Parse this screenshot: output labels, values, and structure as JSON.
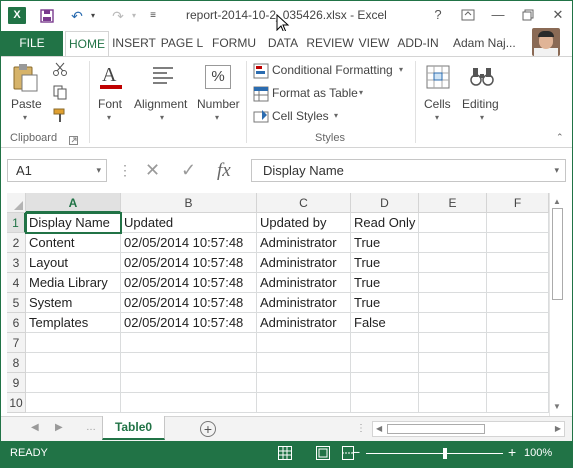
{
  "titlebar": {
    "app_logo": "X",
    "title": "report-2014-10-2_035426.xlsx - Excel",
    "help": "?",
    "minimize": "—",
    "close": "✕"
  },
  "tabs": {
    "file": "FILE",
    "items": [
      "HOME",
      "INSERT",
      "PAGE L",
      "FORMU",
      "DATA",
      "REVIEW",
      "VIEW",
      "ADD-IN"
    ],
    "user": "Adam Naj..."
  },
  "ribbon": {
    "clipboard": {
      "paste": "Paste",
      "group_label": "Clipboard"
    },
    "font": {
      "label": "Font"
    },
    "alignment": {
      "label": "Alignment"
    },
    "number": {
      "label": "Number"
    },
    "styles": {
      "conditional": "Conditional Formatting",
      "format_table": "Format as Table",
      "cell_styles": "Cell Styles",
      "group_label": "Styles"
    },
    "cells": {
      "label": "Cells"
    },
    "editing": {
      "label": "Editing"
    }
  },
  "formula_bar": {
    "name_box": "A1",
    "fx": "fx",
    "content": "Display Name"
  },
  "grid": {
    "columns": [
      "A",
      "B",
      "C",
      "D",
      "E",
      "F"
    ],
    "row_numbers": [
      "1",
      "2",
      "3",
      "4",
      "5",
      "6",
      "7",
      "8",
      "9",
      "10"
    ],
    "rows": [
      [
        "Display Name",
        "Updated",
        "Updated by",
        "Read Only"
      ],
      [
        "Content",
        "02/05/2014 10:57:48",
        "Administrator",
        "True"
      ],
      [
        "Layout",
        "02/05/2014 10:57:48",
        "Administrator",
        "True"
      ],
      [
        "Media Library",
        "02/05/2014 10:57:48",
        "Administrator",
        "True"
      ],
      [
        "System",
        "02/05/2014 10:57:48",
        "Administrator",
        "True"
      ],
      [
        "Templates",
        "02/05/2014 10:57:48",
        "Administrator",
        "False"
      ]
    ]
  },
  "sheets": {
    "active": "Table0"
  },
  "statusbar": {
    "status": "READY",
    "zoom": "100%"
  },
  "colors": {
    "accent": "#217346",
    "selected_header": "#e1e1e1"
  }
}
